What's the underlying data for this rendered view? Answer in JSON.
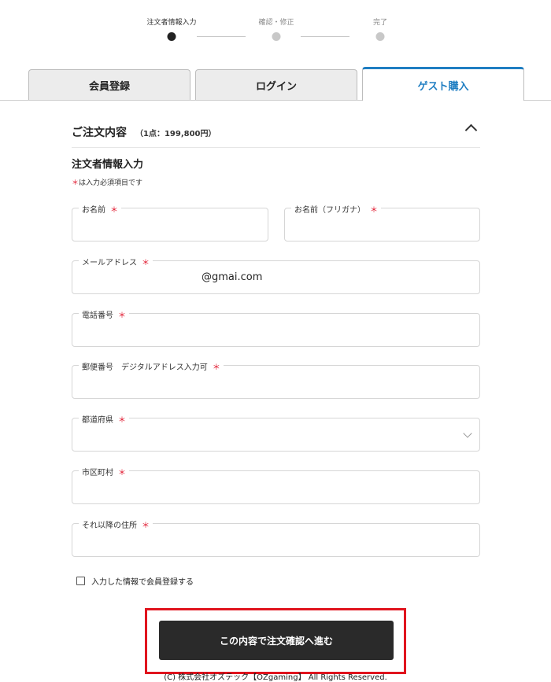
{
  "steps": [
    {
      "label": "注文者情報入力",
      "state": "current"
    },
    {
      "label": "確認・修正",
      "state": "upcoming"
    },
    {
      "label": "完了",
      "state": "upcoming"
    }
  ],
  "tabs": [
    {
      "label": "会員登録",
      "active": false
    },
    {
      "label": "ログイン",
      "active": false
    },
    {
      "label": "ゲスト購入",
      "active": true
    }
  ],
  "order_summary": {
    "title": "ご注文内容",
    "count": "（1点：199,800円）",
    "expanded": true
  },
  "form": {
    "title": "注文者情報入力",
    "required_mark": "＊",
    "required_note": "は入力必須項目です",
    "fields": {
      "name": {
        "label": "お名前",
        "value": ""
      },
      "name_kana": {
        "label": "お名前（フリガナ）",
        "value": ""
      },
      "email": {
        "label": "メールアドレス",
        "value": "@gmai.com"
      },
      "phone": {
        "label": "電話番号",
        "value": ""
      },
      "postal": {
        "label": "郵便番号　デジタルアドレス入力可",
        "value": ""
      },
      "prefecture": {
        "label": "都道府県",
        "value": ""
      },
      "city": {
        "label": "市区町村",
        "value": ""
      },
      "address": {
        "label": "それ以降の住所",
        "value": ""
      }
    },
    "register_checkbox": {
      "label": "入力した情報で会員登録する",
      "checked": false
    },
    "submit_label": "この内容で注文確認へ進む"
  },
  "footer": {
    "copyright": "(C) 株式会社オズテック【OZgaming】 All Rights Reserved."
  },
  "colors": {
    "accent": "#1f7ec2",
    "required": "#e0142b",
    "button": "#2a2a2a",
    "highlight": "#e0141e"
  }
}
